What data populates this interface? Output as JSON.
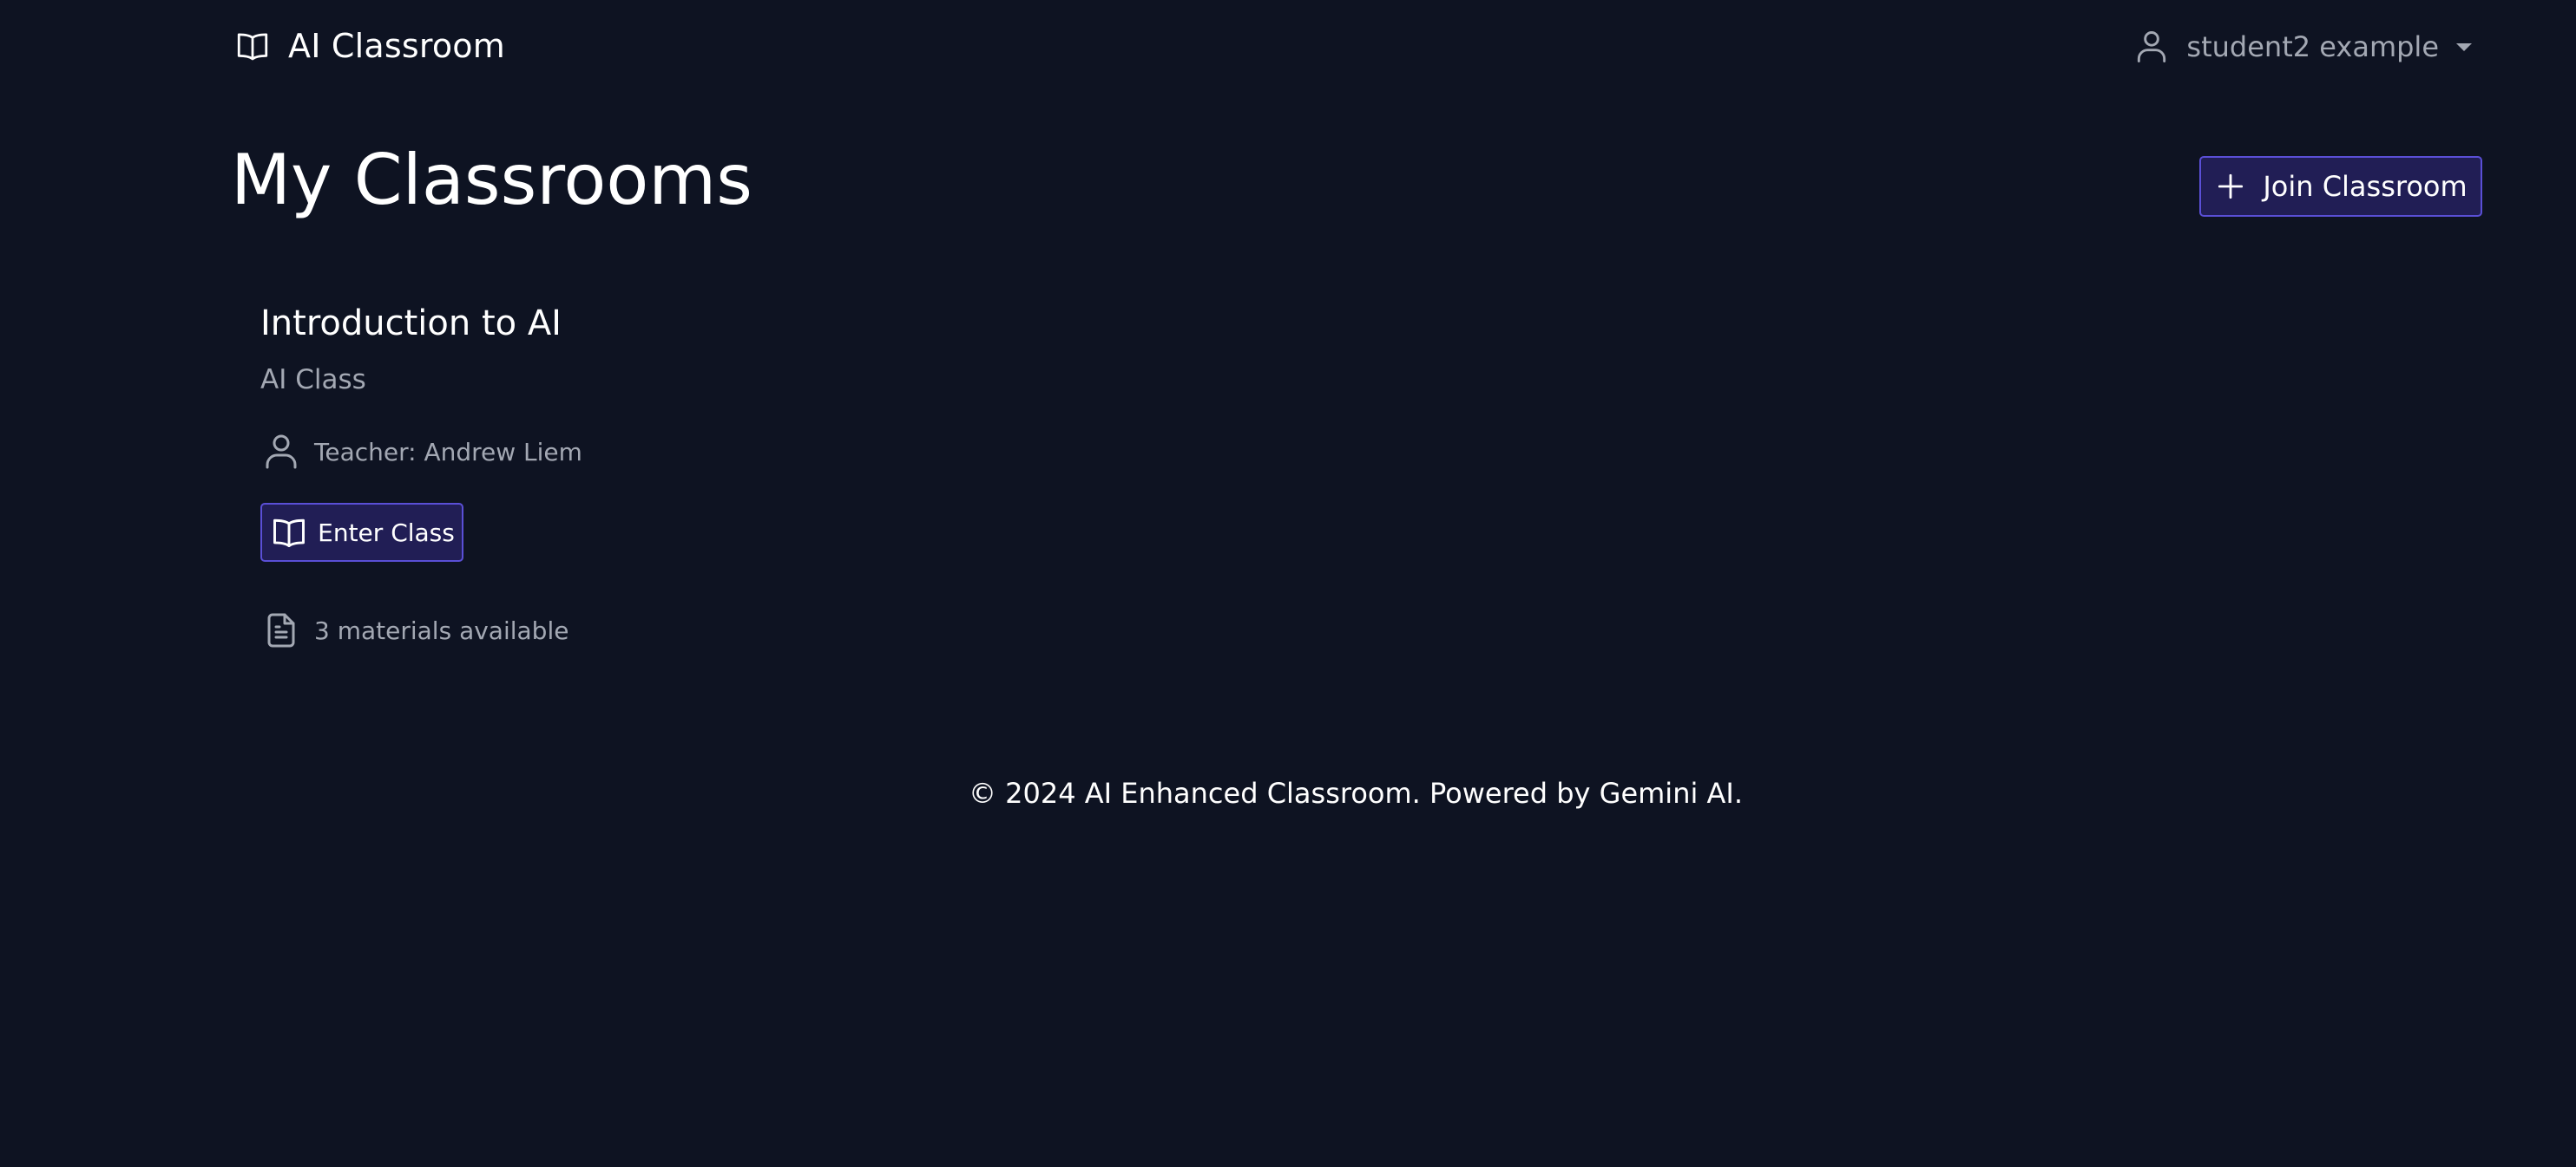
{
  "navbar": {
    "brand": "AI Classroom",
    "brand_icon": "book-open-icon",
    "user_name": "student2 example",
    "user_icon": "user-icon"
  },
  "page": {
    "title": "My Classrooms",
    "join_button": "Join Classroom",
    "join_icon": "plus-icon"
  },
  "classrooms": [
    {
      "title": "Introduction to AI",
      "subtitle": "AI Class",
      "teacher": "Teacher: Andrew Liem",
      "enter_button": "Enter Class",
      "materials": "3 materials available"
    }
  ],
  "footer": {
    "text": "© 2024 AI Enhanced Classroom. Powered by Gemini AI."
  },
  "colors": {
    "background": "#0e1322",
    "button_bg": "#211e55",
    "button_border": "#5a4fd6",
    "muted_text": "#a3a8b3",
    "text": "#ffffff"
  }
}
